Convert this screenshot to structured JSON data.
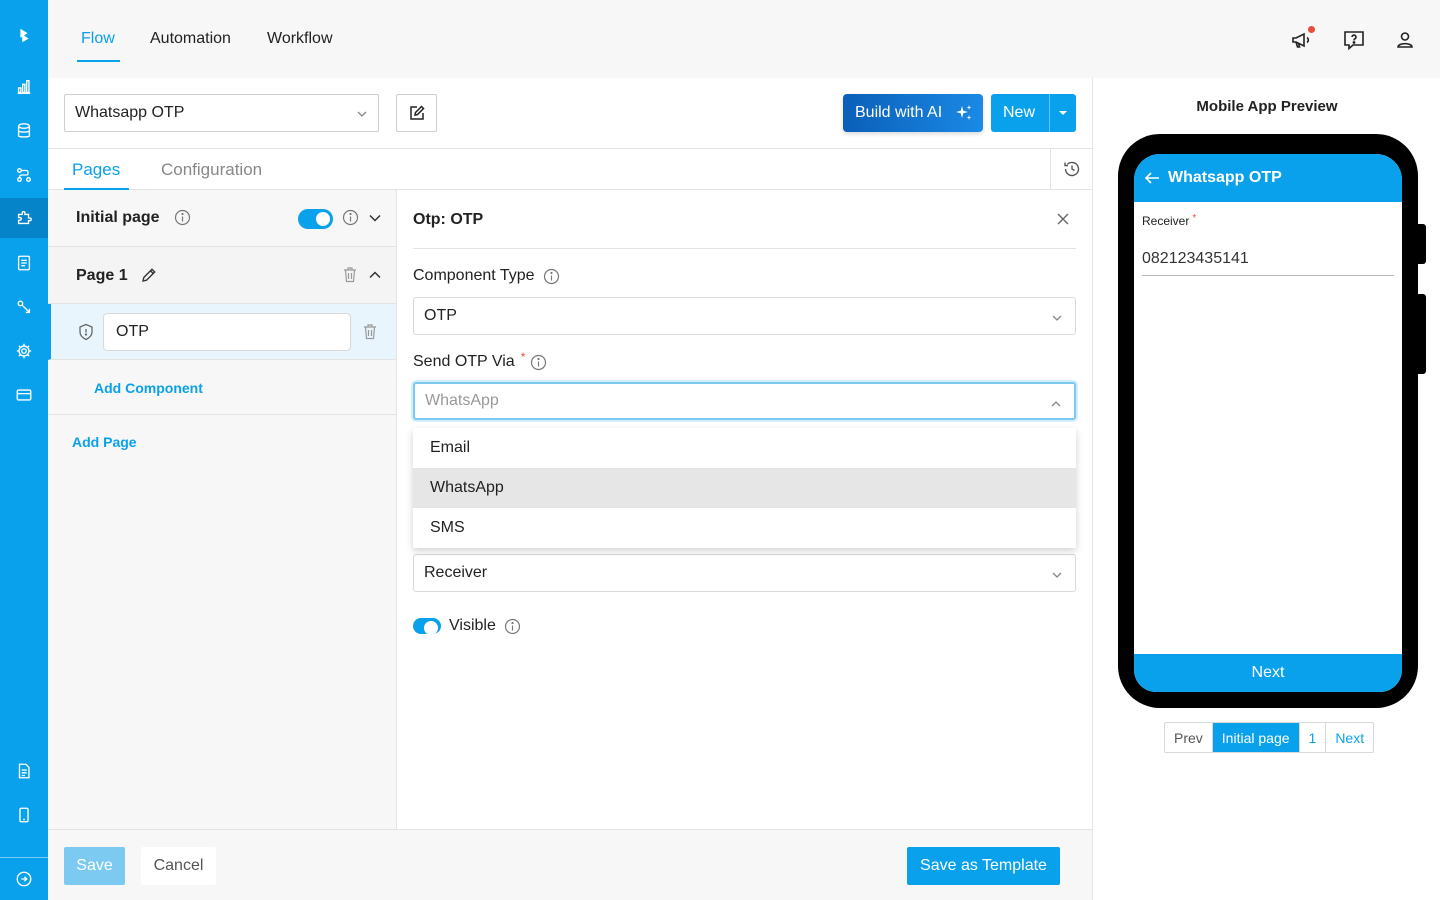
{
  "top_nav": {
    "tabs": [
      "Flow",
      "Automation",
      "Workflow"
    ],
    "active_tab": "Flow"
  },
  "toolbar": {
    "flow_name": "Whatsapp OTP",
    "build_ai_label": "Build with AI",
    "new_label": "New"
  },
  "sub_tabs": [
    "Pages",
    "Configuration"
  ],
  "pages_panel": {
    "initial_page_label": "Initial page",
    "page1_label": "Page 1",
    "component_value": "OTP",
    "add_component_label": "Add Component",
    "add_page_label": "Add Page"
  },
  "properties": {
    "title": "Otp: OTP",
    "component_type_label": "Component Type",
    "component_type_value": "OTP",
    "send_via_label": "Send OTP Via",
    "required_mark": "*",
    "send_via_placeholder": "WhatsApp",
    "options": [
      "Email",
      "WhatsApp",
      "SMS"
    ],
    "selected_option": "WhatsApp",
    "receiver_value": "Receiver",
    "visible_label": "Visible"
  },
  "footer": {
    "save_label": "Save",
    "cancel_label": "Cancel",
    "template_label": "Save as Template"
  },
  "preview": {
    "title": "Mobile App Preview",
    "screen_title": "Whatsapp OTP",
    "receiver_label": "Receiver",
    "receiver_value": "082123435141",
    "next_label": "Next",
    "pager": [
      "Prev",
      "Initial page",
      "1",
      "Next"
    ]
  },
  "colors": {
    "accent": "#0aa1ec",
    "sidebar": "#0aa1ec",
    "ai_gradient_start": "#0b5fb8",
    "required": "#e74c3c"
  },
  "icons": {
    "sidebar": [
      "logo-icon",
      "chart-icon",
      "database-icon",
      "flow-icon",
      "puzzle-icon",
      "document-icon",
      "tag-icon",
      "gear-icon",
      "card-icon",
      "file-icon",
      "mobile-icon",
      "logout-icon"
    ],
    "top_right": [
      "megaphone-icon",
      "help-icon",
      "user-icon"
    ]
  }
}
